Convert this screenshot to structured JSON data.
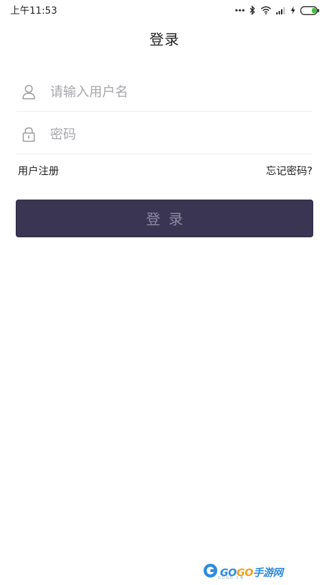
{
  "status_bar": {
    "time": "上午11:53",
    "icons": [
      "more-dots-icon",
      "bluetooth-icon",
      "wifi-icon",
      "signal-icon",
      "charging-icon",
      "battery-icon"
    ],
    "battery_color": "#3cc13c"
  },
  "header": {
    "title": "登录"
  },
  "form": {
    "username": {
      "placeholder": "请输入用户名",
      "value": "",
      "icon": "user-icon"
    },
    "password": {
      "placeholder": "密码",
      "value": "",
      "icon": "lock-icon"
    }
  },
  "links": {
    "register": "用户注册",
    "forgot": "忘记密码?"
  },
  "login_button": {
    "label": "登录",
    "background": "#393553"
  },
  "watermark": {
    "brand_a": "GO",
    "brand_b": "GO",
    "brand_c": "手游网",
    "sub": "GOGO.CN"
  }
}
